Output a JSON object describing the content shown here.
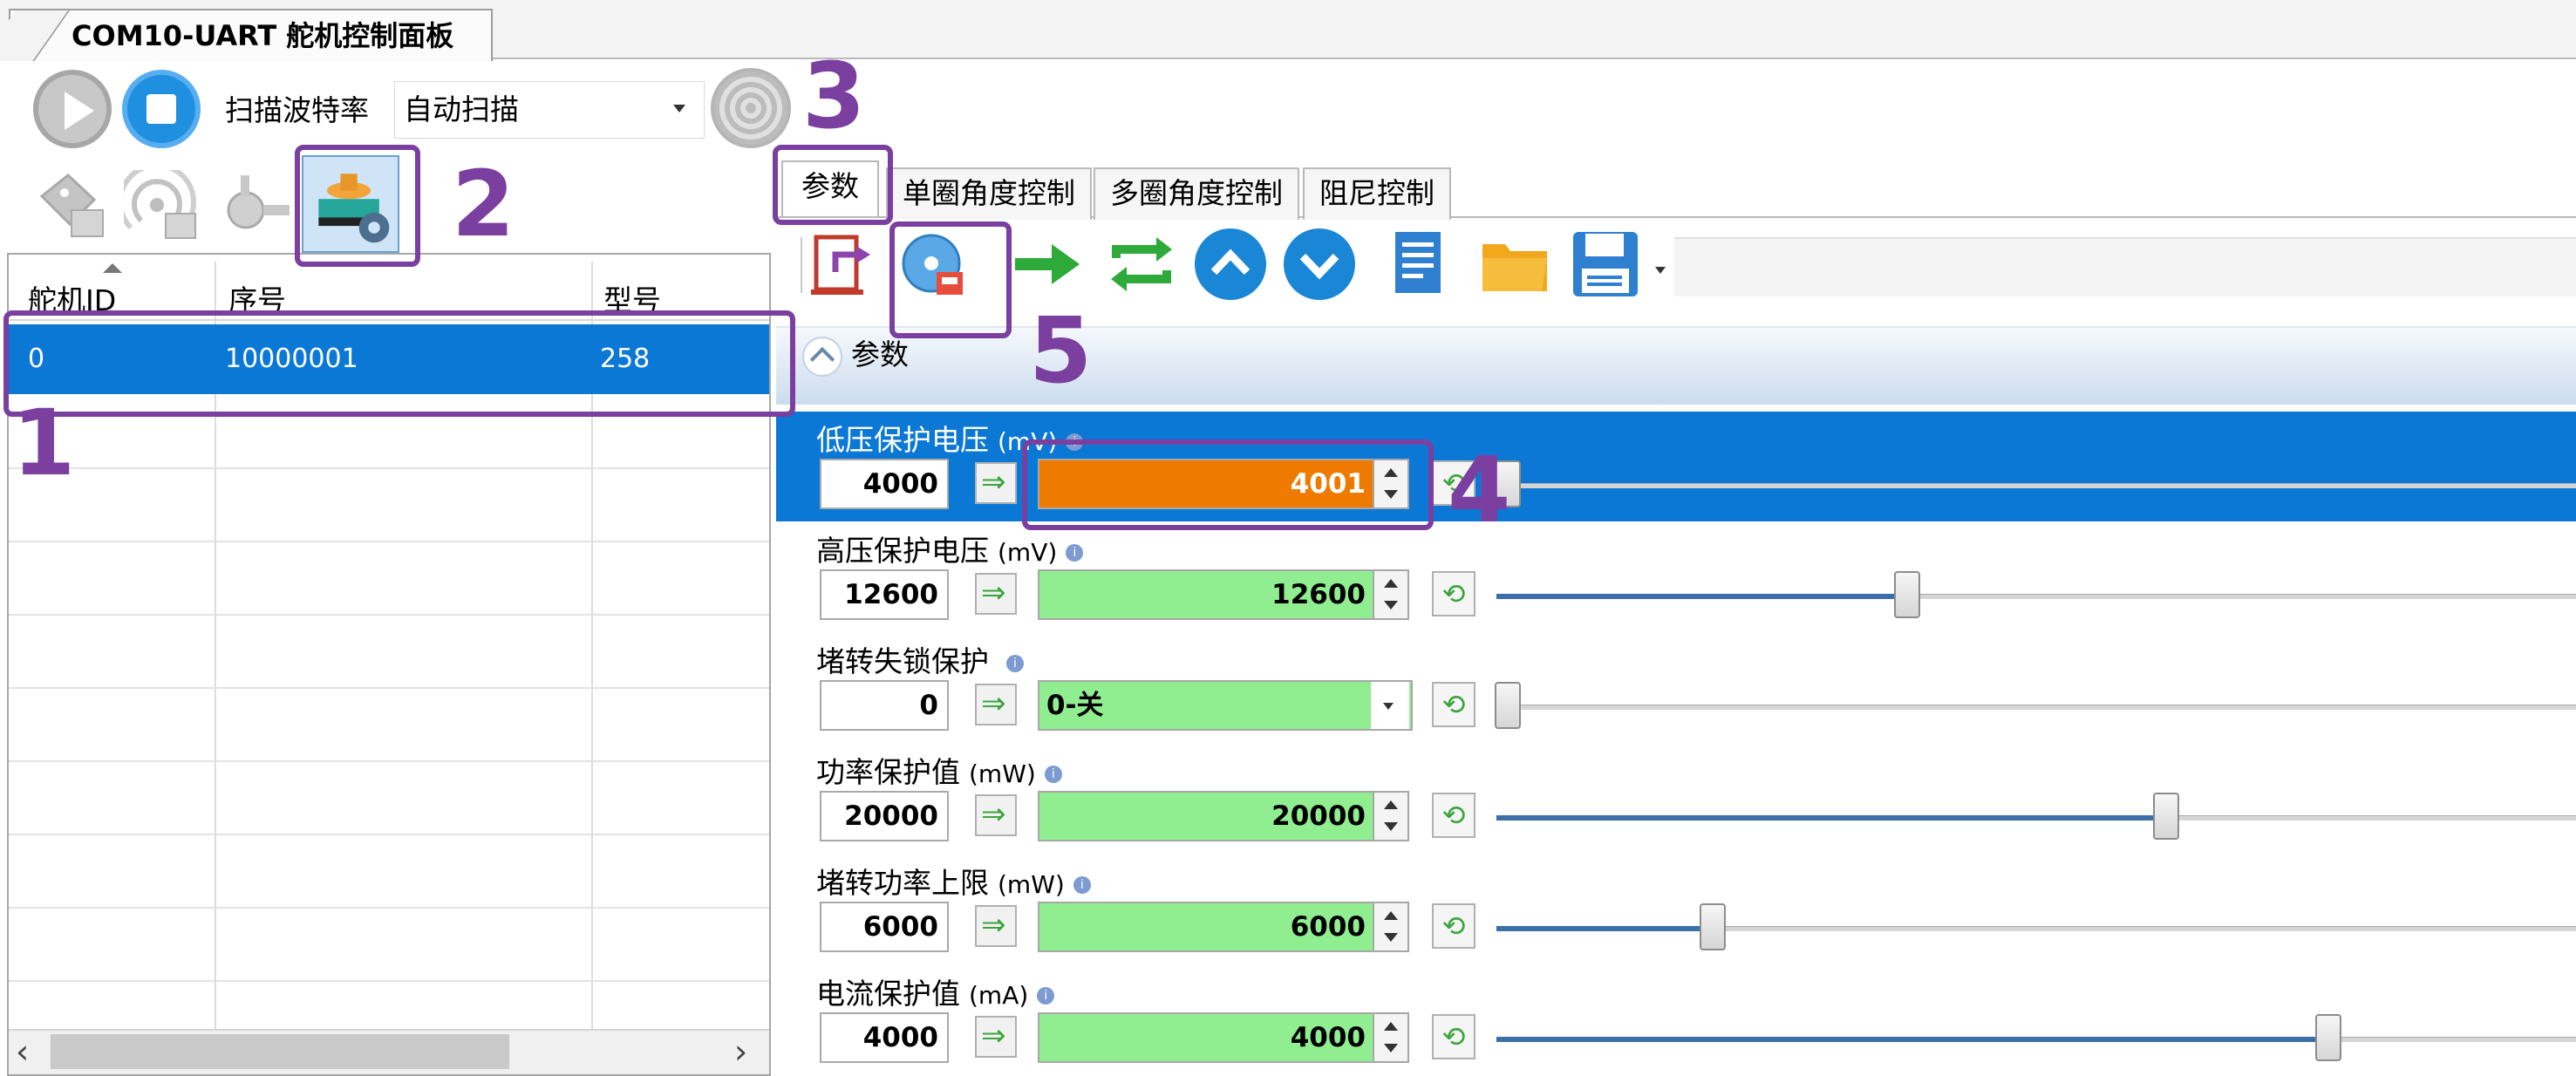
{
  "window": {
    "tab_title": "COM10-UART 舵机控制面板"
  },
  "scan_toolbar": {
    "baud_label": "扫描波特率",
    "baud_value": "自动扫描"
  },
  "servo_list": {
    "columns": [
      "舵机ID",
      "序号",
      "型号"
    ],
    "rows": [
      {
        "id": "0",
        "serial": "10000001",
        "model": "258"
      }
    ]
  },
  "tabs": [
    "参数",
    "单圈角度控制",
    "多圈角度控制",
    "阻尼控制"
  ],
  "section_title": "参数",
  "annotations": [
    "1",
    "2",
    "3",
    "4",
    "5"
  ],
  "params": [
    {
      "label": "低压保护电压",
      "unit": "(mV)",
      "readback": "4000",
      "value": "4001",
      "slider_frac": 0.0,
      "selected": true
    },
    {
      "label": "高压保护电压",
      "unit": "(mV)",
      "readback": "12600",
      "value": "12600",
      "slider_frac": 0.37
    },
    {
      "label": "堵转失锁保护",
      "unit": "",
      "readback": "0",
      "value": "0-关",
      "slider_frac": 0.0,
      "combo": true
    },
    {
      "label": "功率保护值",
      "unit": "(mW)",
      "readback": "20000",
      "value": "20000",
      "slider_frac": 0.61
    },
    {
      "label": "堵转功率上限",
      "unit": "(mW)",
      "readback": "6000",
      "value": "6000",
      "slider_frac": 0.19
    },
    {
      "label": "电流保护值",
      "unit": "(mA)",
      "readback": "4000",
      "value": "4000",
      "slider_frac": 0.76
    }
  ],
  "colors": {
    "accent": "#0b78d6",
    "edit_green": "#90ee90",
    "edit_modified": "#ee7b00",
    "annotation": "#7b3fa0"
  }
}
